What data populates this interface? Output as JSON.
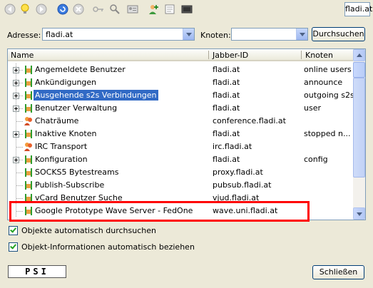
{
  "toolbar": {
    "icons": [
      "back-icon",
      "bulb-icon",
      "forward-icon",
      "refresh-icon",
      "stop-icon",
      "key-icon",
      "search-icon",
      "vcard-icon",
      "add-user-icon",
      "info-icon",
      "terminal-icon"
    ],
    "jid_field": "fladi.at"
  },
  "address": {
    "label": "Adresse:",
    "value": "fladi.at",
    "node_label": "Knoten:",
    "node_value": "",
    "search_button": "Durchsuchen"
  },
  "tree": {
    "columns": [
      "Name",
      "Jabber-ID",
      "Knoten"
    ],
    "rows": [
      {
        "name": "Angemeldete Benutzer",
        "jid": "fladi.at",
        "node": "online users",
        "expandable": true,
        "icon": "green-node-icon"
      },
      {
        "name": "Ankündigungen",
        "jid": "fladi.at",
        "node": "announce",
        "expandable": true,
        "icon": "green-node-icon"
      },
      {
        "name": "Ausgehende s2s Verbindungen",
        "jid": "fladi.at",
        "node": "outgoing s2s",
        "expandable": true,
        "icon": "green-node-icon",
        "selected": true
      },
      {
        "name": "Benutzer Verwaltung",
        "jid": "fladi.at",
        "node": "user",
        "expandable": true,
        "icon": "green-node-icon"
      },
      {
        "name": "Chaträume",
        "jid": "conference.fladi.at",
        "node": "",
        "expandable": false,
        "icon": "chatroom-icon"
      },
      {
        "name": "Inaktive Knoten",
        "jid": "fladi.at",
        "node": "stopped n...",
        "expandable": true,
        "icon": "green-node-icon"
      },
      {
        "name": "IRC Transport",
        "jid": "irc.fladi.at",
        "node": "",
        "expandable": false,
        "icon": "irc-transport-icon"
      },
      {
        "name": "Konfiguration",
        "jid": "fladi.at",
        "node": "config",
        "expandable": true,
        "icon": "green-node-icon"
      },
      {
        "name": "SOCKS5 Bytestreams",
        "jid": "proxy.fladi.at",
        "node": "",
        "expandable": false,
        "icon": "green-node-icon"
      },
      {
        "name": "Publish-Subscribe",
        "jid": "pubsub.fladi.at",
        "node": "",
        "expandable": false,
        "icon": "green-node-icon"
      },
      {
        "name": "vCard Benutzer Suche",
        "jid": "vjud.fladi.at",
        "node": "",
        "expandable": false,
        "icon": "green-node-icon"
      },
      {
        "name": "Google Prototype Wave Server - FedOne",
        "jid": "wave.uni.fladi.at",
        "node": "",
        "expandable": false,
        "icon": "green-node-icon"
      }
    ]
  },
  "options": {
    "auto_browse": "Objekte automatisch durchsuchen",
    "auto_info": "Objekt-Informationen automatisch beziehen"
  },
  "footer": {
    "logo": "PSI",
    "close_button": "Schließen"
  },
  "colors": {
    "selection": "#316ac5",
    "highlight_box": "#ff0000",
    "window_bg": "#ece9d8"
  }
}
